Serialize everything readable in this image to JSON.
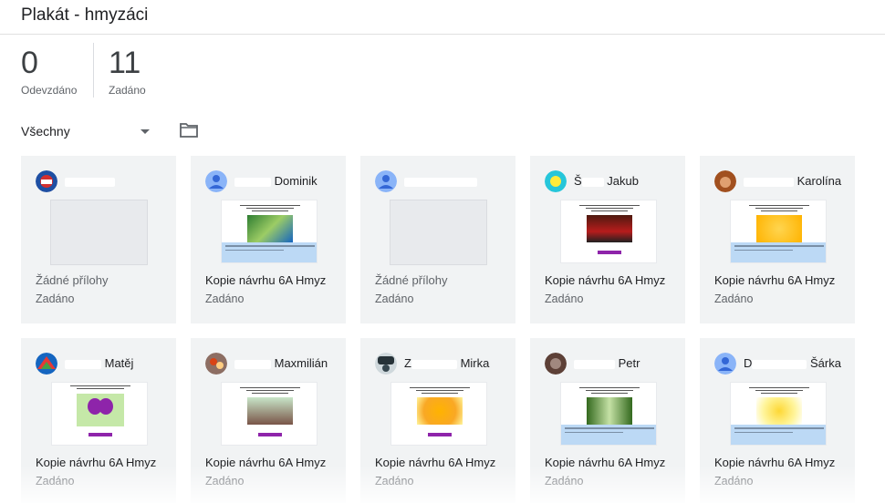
{
  "page": {
    "title": "Plakát - hmyzáci"
  },
  "stats": {
    "submitted": {
      "value": "0",
      "label": "Odevzdáno"
    },
    "assigned": {
      "value": "11",
      "label": "Zadáno"
    }
  },
  "filter": {
    "selected": "Všechny"
  },
  "cards": [
    {
      "name": "",
      "attachment": "Žádné přílohy",
      "status": "Zadáno",
      "has_attachment": false
    },
    {
      "name": "Dominik",
      "attachment": "Kopie návrhu 6A Hmyz",
      "status": "Zadáno",
      "has_attachment": true
    },
    {
      "name": "",
      "attachment": "Žádné přílohy",
      "status": "Zadáno",
      "has_attachment": false
    },
    {
      "name": "Jakub",
      "attachment": "Kopie návrhu 6A Hmyz",
      "status": "Zadáno",
      "has_attachment": true
    },
    {
      "name": "Karolína",
      "attachment": "Kopie návrhu 6A Hmyz",
      "status": "Zadáno",
      "has_attachment": true
    },
    {
      "name": "Matěj",
      "attachment": "Kopie návrhu 6A Hmyz",
      "status": "Zadáno",
      "has_attachment": true
    },
    {
      "name": "Maxmilián",
      "attachment": "Kopie návrhu 6A Hmyz",
      "status": "Zadáno",
      "has_attachment": true
    },
    {
      "name": "Mirka",
      "attachment": "Kopie návrhu 6A Hmyz",
      "status": "Zadáno",
      "has_attachment": true
    },
    {
      "name": "Petr",
      "attachment": "Kopie návrhu 6A Hmyz",
      "status": "Zadáno",
      "has_attachment": true
    },
    {
      "name": "Šárka",
      "attachment": "Kopie návrhu 6A Hmyz",
      "status": "Zadáno",
      "has_attachment": true
    }
  ],
  "colors": {
    "card_bg": "#f1f3f4",
    "accent_purple": "#8e24aa",
    "avatar_blue": "#8ab4f8"
  }
}
